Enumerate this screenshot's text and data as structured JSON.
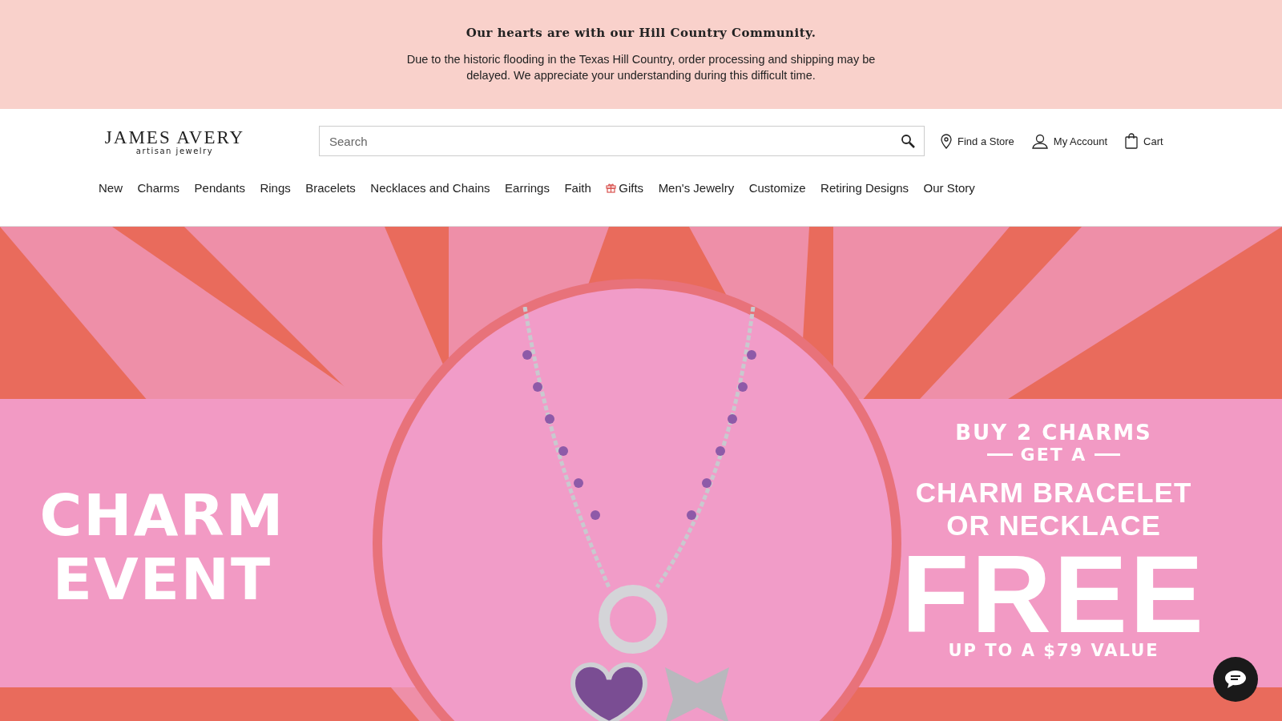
{
  "notice": {
    "title": "Our hearts are with our Hill Country Community.",
    "message": "Due to the historic flooding in the Texas Hill Country, order processing and shipping may be delayed. We appreciate your understanding during this difficult time."
  },
  "header": {
    "logo": {
      "name": "JAMES AVERY",
      "tagline": "artisan jewelry"
    },
    "search": {
      "placeholder": "Search"
    },
    "links": [
      {
        "kind": "store",
        "label": "Find a Store"
      },
      {
        "kind": "account",
        "label": "My Account"
      },
      {
        "kind": "cart",
        "label": "Cart"
      }
    ]
  },
  "nav": [
    {
      "label": "New"
    },
    {
      "label": "Charms"
    },
    {
      "label": "Pendants"
    },
    {
      "label": "Rings"
    },
    {
      "label": "Bracelets"
    },
    {
      "label": "Necklaces and Chains"
    },
    {
      "label": "Earrings"
    },
    {
      "label": "Faith"
    },
    {
      "label": "Gifts",
      "kind": "gift"
    },
    {
      "label": "Men's Jewelry"
    },
    {
      "label": "Customize"
    },
    {
      "label": "Retiring Designs"
    },
    {
      "label": "Our Story"
    }
  ],
  "hero": {
    "title_lines": [
      "CHARM",
      "EVENT"
    ],
    "offer_top": "BUY 2 CHARMS",
    "offer_connector": "GET A",
    "offer_item_lines": [
      "CHARM BRACELET",
      "OR NECKLACE"
    ],
    "offer_big": "FREE",
    "offer_note": "UP TO A $79 VALUE"
  }
}
